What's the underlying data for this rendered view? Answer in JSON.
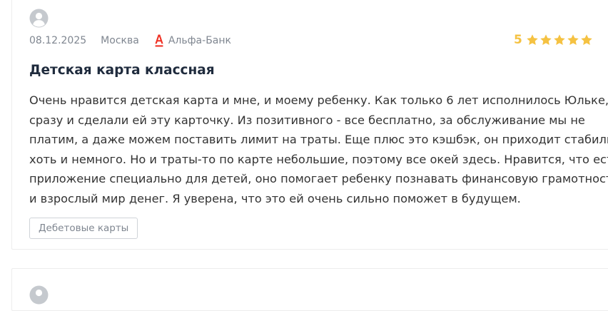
{
  "review": {
    "date": "08.12.2025",
    "city": "Москва",
    "bank": "Альфа-Банк",
    "rating": "5",
    "rating_stars": 5,
    "title": "Детская карта классная",
    "text_lines": [
      "Очень нравится детская карта и мне, и моему ребенку. Как только 6 лет исполнилось Юльке, т",
      "сразу и сделали ей эту карточку. Из позитивного - все бесплатно, за обслуживание мы не",
      "платим, а даже можем поставить лимит на траты. Еще плюс это кэшбэк, он приходит стабильн",
      "хоть и немного. Но и траты-то по карте небольшие, поэтому все окей здесь. Нравится, что ест",
      "приложение специально для детей, оно помогает ребенку познавать финансовую грамотност",
      "и взрослый мир денег. Я уверена, что это ей очень сильно поможет в будущем."
    ],
    "tag": "Дебетовые карты"
  },
  "colors": {
    "star": "#f5c242",
    "bank_logo": "#ef3124",
    "avatar": "#c5c9ce"
  },
  "icons": {
    "avatar": "user-avatar-icon",
    "bank": "alfa-bank-logo-icon",
    "star": "star-icon"
  }
}
